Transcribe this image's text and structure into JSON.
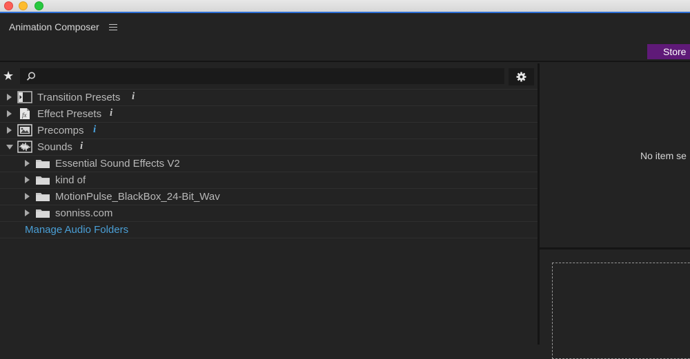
{
  "window": {
    "controls": [
      "close",
      "minimize",
      "maximize"
    ]
  },
  "panel": {
    "title": "Animation Composer",
    "menu_icon": "hamburger-menu-icon",
    "store_label": "Store"
  },
  "search": {
    "value": "",
    "placeholder": "",
    "favorites_icon": "star-icon",
    "search_icon": "magnifier-icon",
    "settings_icon": "gear-icon"
  },
  "tree": {
    "categories": [
      {
        "label": "Transition Presets",
        "icon": "transition-preset-icon",
        "expanded": false
      },
      {
        "label": "Effect Presets",
        "icon": "effect-preset-icon",
        "expanded": false
      },
      {
        "label": "Precomps",
        "icon": "precomp-icon",
        "expanded": false
      },
      {
        "label": "Sounds",
        "icon": "sound-wave-icon",
        "expanded": true
      }
    ],
    "sound_folders": [
      {
        "label": "Essential Sound Effects V2"
      },
      {
        "label": "kind of"
      },
      {
        "label": "MotionPulse_BlackBox_24-Bit_Wav"
      },
      {
        "label": "sonniss.com"
      }
    ],
    "manage_link": "Manage Audio Folders"
  },
  "preview": {
    "empty_text": "No item se"
  },
  "colors": {
    "background": "#232323",
    "store_button": "#5f1a78",
    "link": "#4a9fd6",
    "info_active": "#4aa3df"
  }
}
